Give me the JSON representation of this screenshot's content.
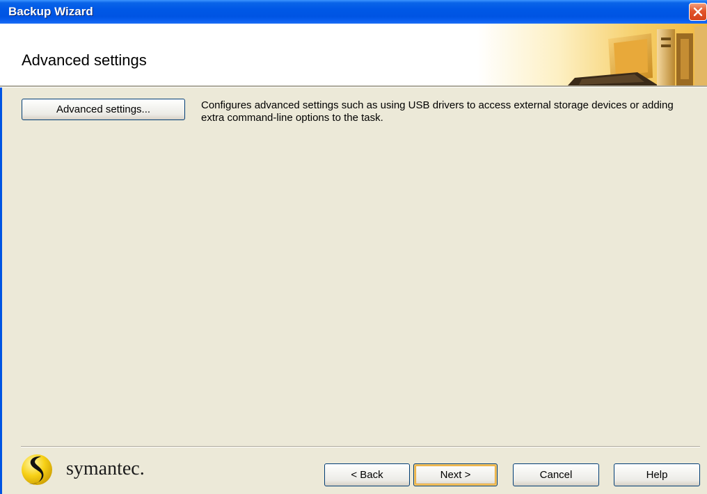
{
  "window": {
    "title": "Backup Wizard",
    "close_icon": "close-icon"
  },
  "header": {
    "title": "Advanced settings",
    "art": "computer-illustration"
  },
  "content": {
    "advanced_button_label": "Advanced settings...",
    "description": "Configures advanced settings such as using USB drivers to access external storage devices or adding extra command-line options to the task."
  },
  "footer": {
    "logo_text": "symantec.",
    "buttons": {
      "back": "< Back",
      "next": "Next >",
      "cancel": "Cancel",
      "help": "Help"
    }
  },
  "colors": {
    "titlebar": "#0054e3",
    "dialog_bg": "#ece9d8",
    "default_button_highlight": "#e5a32d",
    "logo_yellow": "#f7d117"
  }
}
